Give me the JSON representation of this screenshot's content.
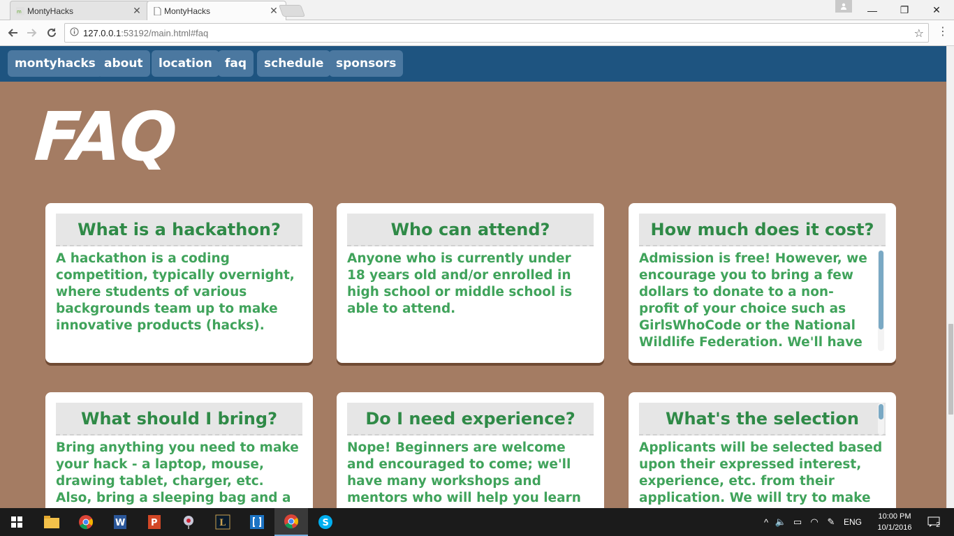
{
  "browser": {
    "tabs": [
      {
        "title": "MontyHacks",
        "active": false
      },
      {
        "title": "MontyHacks",
        "active": true
      }
    ],
    "url_host": "127.0.0.1",
    "url_path": ":53192/main.html#faq",
    "close_glyph": "✕",
    "minimize_glyph": "—",
    "restore_glyph": "❐",
    "window_close_glyph": "✕"
  },
  "site_nav": {
    "items": [
      "montyhacks",
      "about",
      "location",
      "faq",
      "schedule",
      "sponsors"
    ]
  },
  "page": {
    "title": "FAQ",
    "faqs": [
      {
        "question": "What is a hackathon?",
        "answer": "A hackathon is a coding competition, typically overnight, where students of various backgrounds team up to make innovative products (hacks)."
      },
      {
        "question": "Who can attend?",
        "answer": "Anyone who is currently under 18 years old and/or enrolled in high school or middle school is able to attend."
      },
      {
        "question": "How much does it cost?",
        "answer": "Admission is free! However, we encourage you to bring a few dollars to donate to a non-profit of your choice such as GirlsWhoCode or the National Wildlife Federation. We'll have"
      },
      {
        "question": "What should I bring?",
        "answer": "Bring anything you need to make your hack - a laptop, mouse, drawing tablet, charger, etc. Also, bring a sleeping bag and a pillow"
      },
      {
        "question": "Do I need experience?",
        "answer": "Nope! Beginners are welcome and encouraged to come; we'll have many workshops and mentors who will help you learn to make"
      },
      {
        "question": "What's the selection",
        "answer": "Applicants will be selected based upon their expressed interest, experience, etc. from their application. We will try to make"
      }
    ]
  },
  "colors": {
    "page_bg": "#a47c63",
    "nav_bg": "#1e5480",
    "nav_button": "#4b78a0",
    "question_text": "#2f8a47",
    "answer_text": "#40a35b"
  },
  "taskbar": {
    "language": "ENG",
    "time": "10:00 PM",
    "date": "10/1/2016",
    "notifications": "2"
  }
}
